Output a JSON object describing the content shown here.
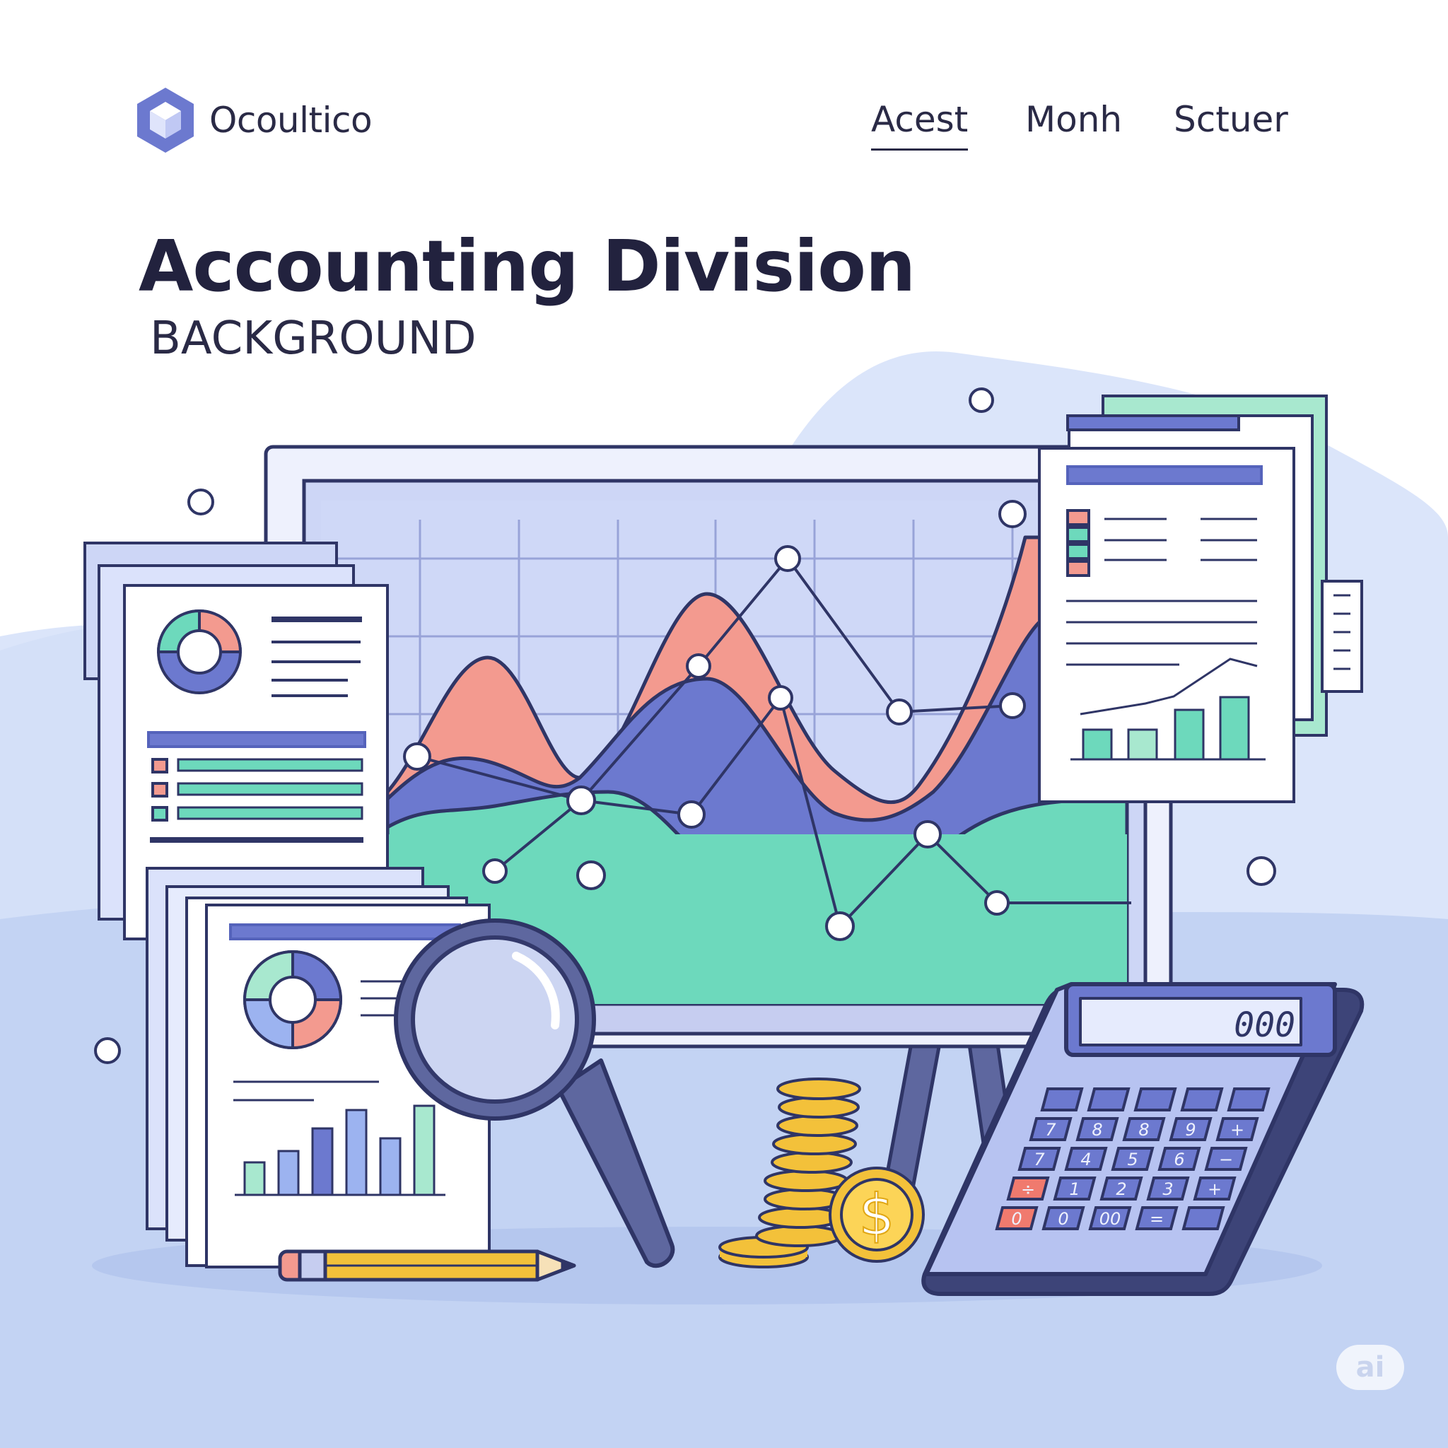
{
  "brand": {
    "name": "Ocoultico",
    "logo_icon": "cube-icon"
  },
  "nav": {
    "items": [
      {
        "label": "Acest",
        "active": true
      },
      {
        "label": "Monh",
        "active": false
      },
      {
        "label": "Sctuer",
        "active": false
      }
    ]
  },
  "hero": {
    "title": "Accounting Division",
    "subtitle": "BACKGROUND"
  },
  "calculator": {
    "display": "000",
    "keys": [
      [
        "",
        "",
        "",
        "",
        ""
      ],
      [
        "7",
        "8",
        "8",
        "9",
        "+"
      ],
      [
        "7",
        "4",
        "5",
        "6",
        "−"
      ],
      [
        "÷",
        "1",
        "2",
        "3",
        "+"
      ],
      [
        "0",
        "0",
        "00",
        "=",
        ""
      ]
    ]
  },
  "coin_symbol": "$",
  "watermark": "ai",
  "colors": {
    "navy": "#2f3566",
    "indigo": "#6c79cf",
    "salmon": "#f39a8f",
    "mint": "#6dd9bc",
    "gold": "#f3c13a",
    "sky_bg": "#cfdcf7"
  }
}
